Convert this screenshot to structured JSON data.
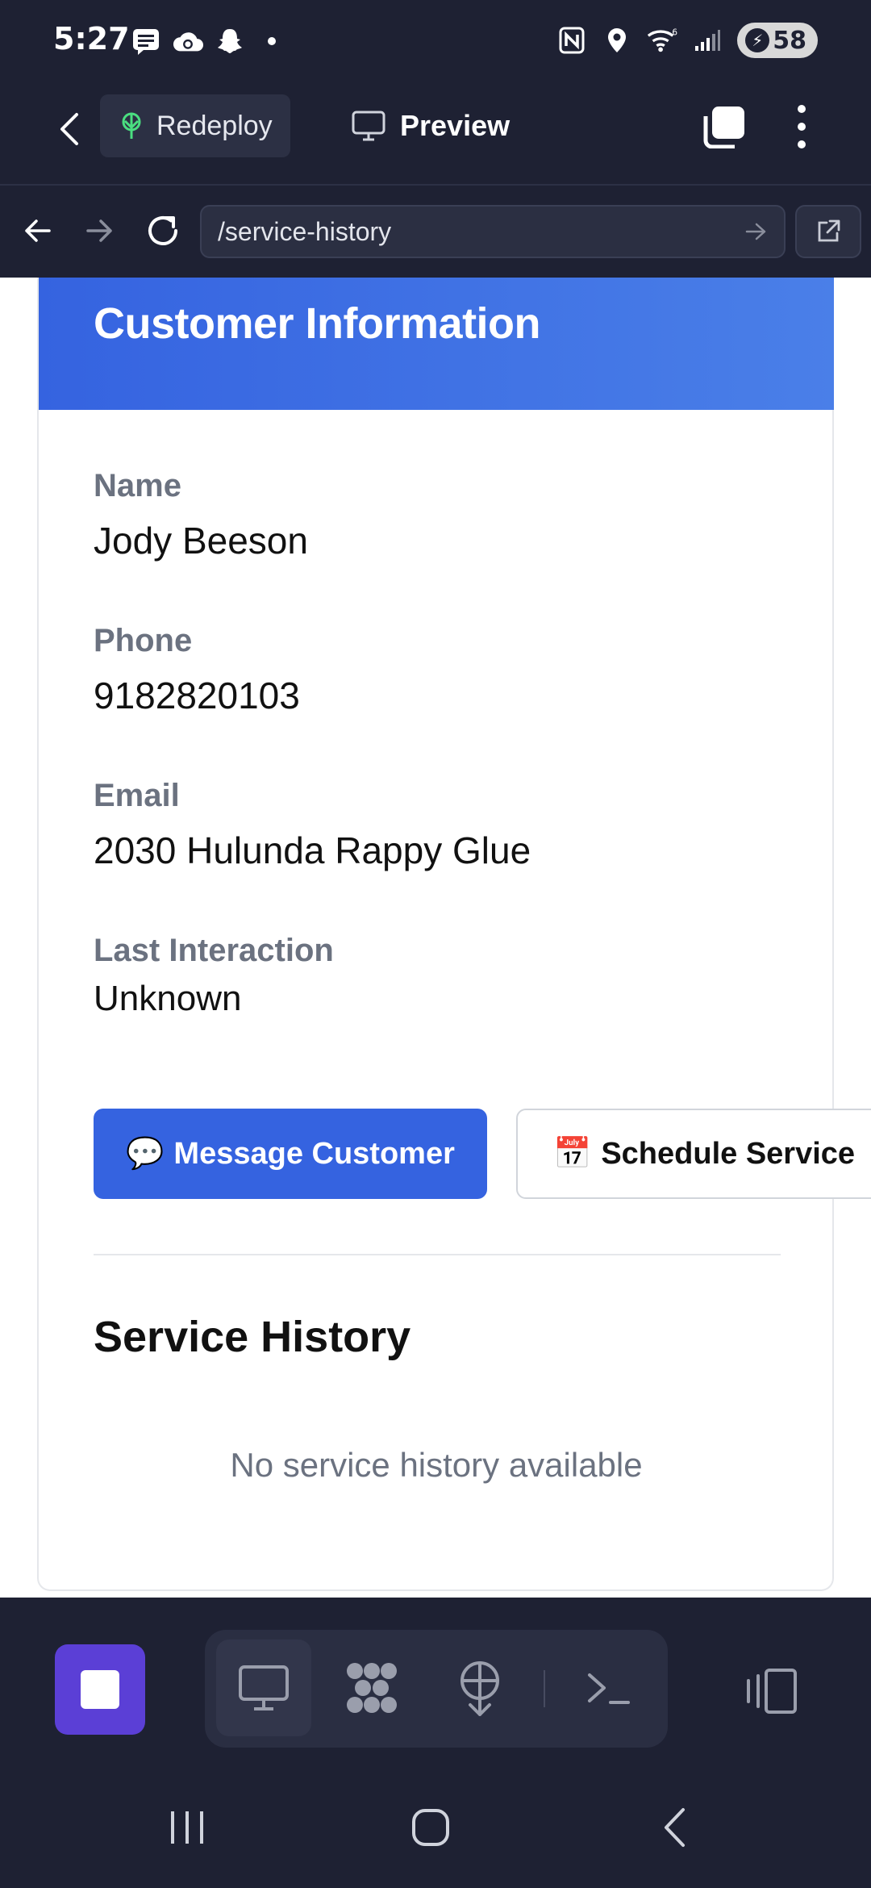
{
  "status_bar": {
    "time": "5:27",
    "battery_level": "58",
    "icons_left": [
      "message-icon",
      "cloud-icon",
      "snapchat-icon",
      "dot-icon"
    ],
    "icons_right": [
      "nfc-icon",
      "location-icon",
      "wifi-icon",
      "signal-icon",
      "battery-icon"
    ]
  },
  "toolbar": {
    "redeploy_label": "Redeploy",
    "preview_label": "Preview"
  },
  "url_bar": {
    "path": "/service-history"
  },
  "customer": {
    "header_title": "Customer Information",
    "name_label": "Name",
    "name_value": "Jody Beeson",
    "phone_label": "Phone",
    "phone_value": "9182820103",
    "email_label": "Email",
    "email_value": "2030 Hulunda Rappy Glue",
    "last_interaction_label": "Last Interaction",
    "last_interaction_value": "Unknown"
  },
  "actions": {
    "message_label": "Message Customer",
    "message_emoji": "💬",
    "schedule_label": "Schedule Service",
    "schedule_emoji": "📅"
  },
  "history": {
    "title": "Service History",
    "empty_message": "No service history available"
  },
  "colors": {
    "accent": "#3563e0",
    "stop_button": "#5b3fd6",
    "app_background": "#1e2133"
  }
}
